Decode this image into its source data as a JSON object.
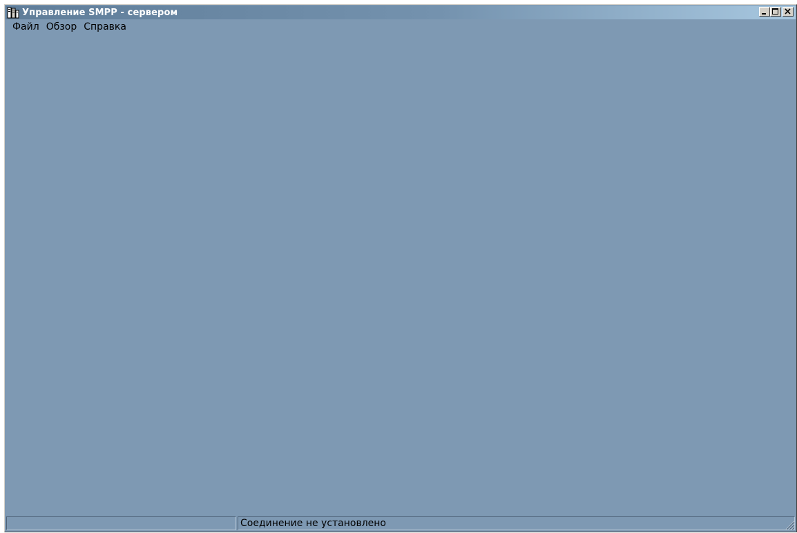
{
  "window": {
    "title": "Управление SMPP - сервером",
    "icon": "server-app-icon"
  },
  "title_buttons": {
    "minimize_icon": "minimize-icon",
    "maximize_icon": "maximize-icon",
    "close_icon": "close-icon"
  },
  "menu": {
    "items": [
      {
        "label": "Файл"
      },
      {
        "label": "Обзор"
      },
      {
        "label": "Справка"
      }
    ]
  },
  "statusbar": {
    "panel1": "",
    "panel2": "Соединение не установлено"
  },
  "colors": {
    "client_bg": "#7e99b3",
    "titlebar_start": "#5f7d99",
    "titlebar_end": "#a8c8e0"
  }
}
